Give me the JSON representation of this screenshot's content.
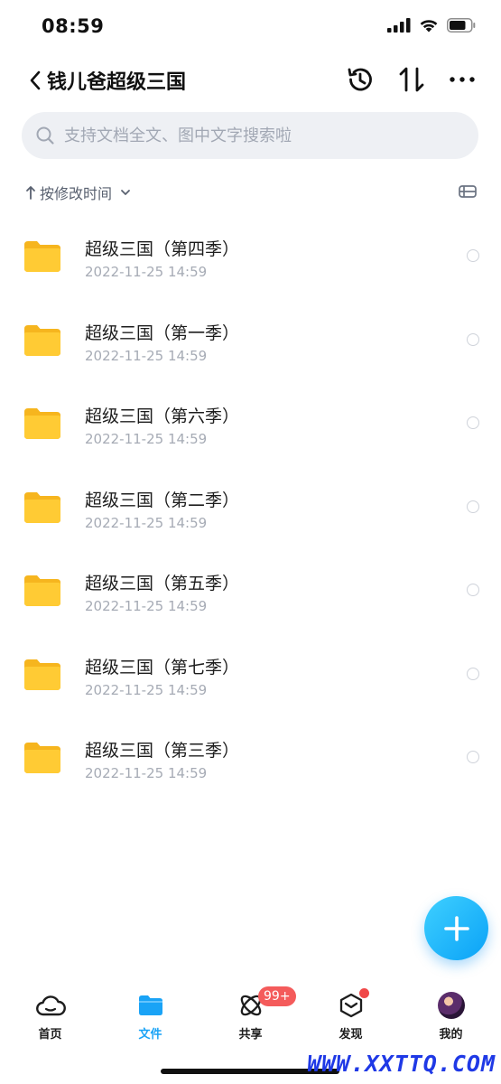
{
  "status": {
    "time": "08:59"
  },
  "header": {
    "title": "钱儿爸超级三国"
  },
  "search": {
    "placeholder": "支持文档全文、图中文字搜索啦"
  },
  "sort": {
    "label": "按修改时间"
  },
  "files": [
    {
      "name": "超级三国（第四季）",
      "date": "2022-11-25 14:59"
    },
    {
      "name": "超级三国（第一季）",
      "date": "2022-11-25 14:59"
    },
    {
      "name": "超级三国（第六季）",
      "date": "2022-11-25 14:59"
    },
    {
      "name": "超级三国（第二季）",
      "date": "2022-11-25 14:59"
    },
    {
      "name": "超级三国（第五季）",
      "date": "2022-11-25 14:59"
    },
    {
      "name": "超级三国（第七季）",
      "date": "2022-11-25 14:59"
    },
    {
      "name": "超级三国（第三季）",
      "date": "2022-11-25 14:59"
    }
  ],
  "nav": {
    "home": "首页",
    "files": "文件",
    "share": "共享",
    "share_badge": "99+",
    "discover": "发现",
    "mine": "我的"
  },
  "watermark": "WWW.XXTTQ.COM",
  "colors": {
    "accent": "#1aa3f6",
    "folder": "#ffc62b",
    "badge": "#f45b5b"
  }
}
